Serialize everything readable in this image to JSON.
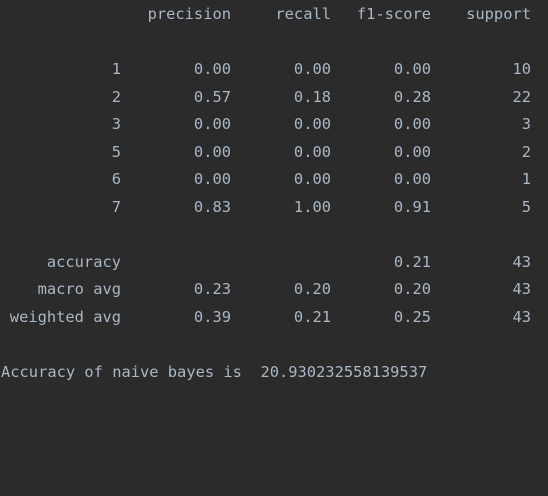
{
  "headers": {
    "precision": "precision",
    "recall": "recall",
    "f1": "f1-score",
    "support": "support"
  },
  "class_rows": [
    {
      "label": "1",
      "precision": "0.00",
      "recall": "0.00",
      "f1": "0.00",
      "support": "10"
    },
    {
      "label": "2",
      "precision": "0.57",
      "recall": "0.18",
      "f1": "0.28",
      "support": "22"
    },
    {
      "label": "3",
      "precision": "0.00",
      "recall": "0.00",
      "f1": "0.00",
      "support": "3"
    },
    {
      "label": "5",
      "precision": "0.00",
      "recall": "0.00",
      "f1": "0.00",
      "support": "2"
    },
    {
      "label": "6",
      "precision": "0.00",
      "recall": "0.00",
      "f1": "0.00",
      "support": "1"
    },
    {
      "label": "7",
      "precision": "0.83",
      "recall": "1.00",
      "f1": "0.91",
      "support": "5"
    }
  ],
  "accuracy_row": {
    "label": "accuracy",
    "f1": "0.21",
    "support": "43"
  },
  "macro_row": {
    "label": "macro avg",
    "precision": "0.23",
    "recall": "0.20",
    "f1": "0.20",
    "support": "43"
  },
  "weighted_row": {
    "label": "weighted avg",
    "precision": "0.39",
    "recall": "0.21",
    "f1": "0.25",
    "support": "43"
  },
  "summary_line": "Accuracy of naive bayes is  20.930232558139537",
  "colors": {
    "background": "#2b2b2b",
    "text": "#a9b7c6"
  }
}
